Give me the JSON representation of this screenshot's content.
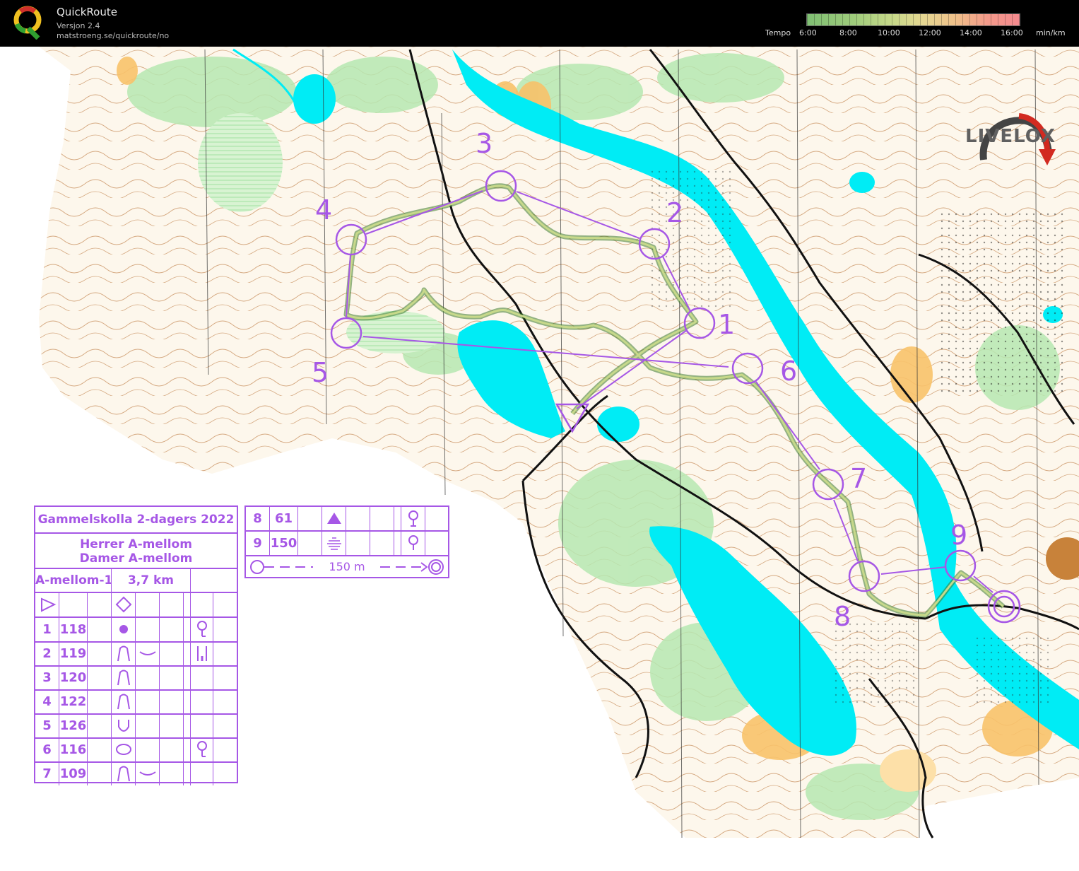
{
  "header": {
    "app_name": "QuickRoute",
    "version": "Versjon 2.4",
    "url": "matstroeng.se/quickroute/no",
    "tempo_label": "Tempo",
    "tempo_ticks": [
      "6:00",
      "8:00",
      "10:00",
      "12:00",
      "14:00",
      "16:00"
    ],
    "tempo_unit": "min/km"
  },
  "watermark": "LIVELOX",
  "colors": {
    "course": "#a657e6",
    "water": "#00ecf5",
    "forest_open": "#f8a73b",
    "green": "#b6e8b2",
    "contour": "#b4692a"
  },
  "controls": [
    "1",
    "2",
    "3",
    "4",
    "5",
    "6",
    "7",
    "8",
    "9"
  ],
  "description_card": {
    "event": "Gammelskolla 2-dagers 2022",
    "classes": [
      "Herrer A-mellom",
      "Damer A-mellom"
    ],
    "course": "A-mellom-1",
    "length": "3,7 km",
    "rows": [
      {
        "num": "1",
        "code": "118"
      },
      {
        "num": "2",
        "code": "119"
      },
      {
        "num": "3",
        "code": "120"
      },
      {
        "num": "4",
        "code": "122"
      },
      {
        "num": "5",
        "code": "126"
      },
      {
        "num": "6",
        "code": "116"
      },
      {
        "num": "7",
        "code": "109"
      }
    ]
  },
  "description_card_2": {
    "rows": [
      {
        "num": "8",
        "code": "61"
      },
      {
        "num": "9",
        "code": "150"
      }
    ],
    "finish_distance": "150 m"
  }
}
